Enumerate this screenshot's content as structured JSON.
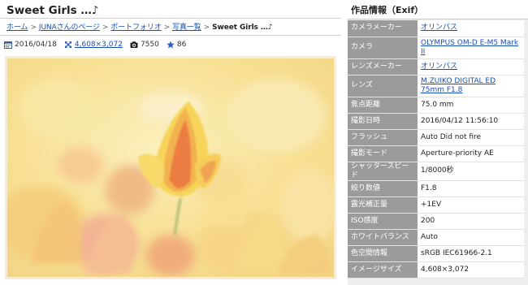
{
  "page": {
    "title": "Sweet Girls …♪",
    "breadcrumb": [
      {
        "label": "ホーム",
        "link": true
      },
      {
        "label": "JUNAさんのページ",
        "link": true
      },
      {
        "label": "ポートフォリオ",
        "link": true
      },
      {
        "label": "写真一覧",
        "link": true
      },
      {
        "label": "Sweet Girls …♪",
        "link": false
      }
    ],
    "breadcrumb_separator": ">",
    "meta": {
      "date": "2016/04/18",
      "size": "4,608×3,072",
      "views": "7550",
      "stars": "86"
    }
  },
  "exif": {
    "title": "作品情報（Exif）",
    "rows": [
      {
        "key": "カメラメーカー",
        "value": "オリンパス",
        "link": true
      },
      {
        "key": "カメラ",
        "value": "OLYMPUS OM-D E-M5 Mark II",
        "link": true
      },
      {
        "key": "レンズメーカー",
        "value": "オリンパス",
        "link": true
      },
      {
        "key": "レンズ",
        "value": "M.ZUIKO DIGITAL ED 75mm F1.8",
        "link": true
      },
      {
        "key": "焦点距離",
        "value": "75.0 mm",
        "link": false
      },
      {
        "key": "撮影日時",
        "value": "2016/04/12 11:56:10",
        "link": false
      },
      {
        "key": "フラッシュ",
        "value": "Auto Did not fire",
        "link": false
      },
      {
        "key": "撮影モード",
        "value": "Aperture-priority AE",
        "link": false
      },
      {
        "key": "シャッタースピード",
        "value": "1/8000秒",
        "link": false
      },
      {
        "key": "絞り数値",
        "value": "F1.8",
        "link": false
      },
      {
        "key": "露光補正量",
        "value": "+1EV",
        "link": false
      },
      {
        "key": "ISO感度",
        "value": "200",
        "link": false
      },
      {
        "key": "ホワイトバランス",
        "value": "Auto",
        "link": false
      },
      {
        "key": "色空間情報",
        "value": "sRGB IEC61966-2.1",
        "link": false
      },
      {
        "key": "イメージサイズ",
        "value": "4,608×3,072",
        "link": false
      }
    ]
  },
  "colors": {
    "link": "#1a4fb3",
    "exif_key_bg": "#9b9b9b",
    "star": "#2b5fc0"
  },
  "icons": {
    "date": "calendar-icon",
    "size": "expand-icon",
    "views": "camera-icon",
    "stars": "star-icon"
  }
}
